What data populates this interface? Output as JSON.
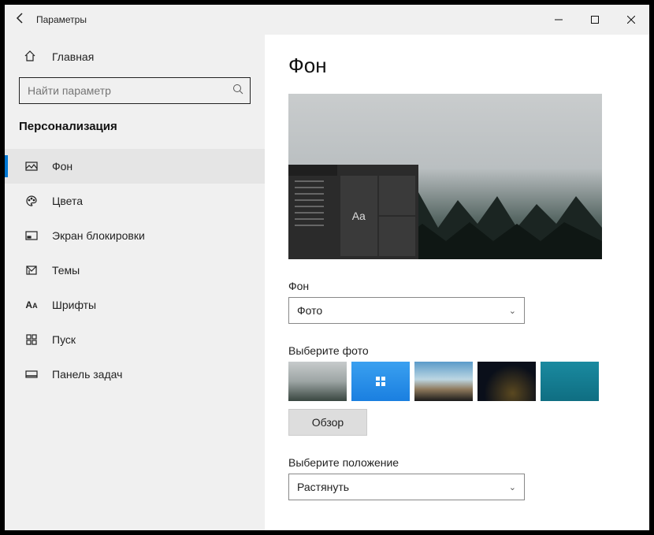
{
  "window": {
    "title": "Параметры"
  },
  "sidebar": {
    "home": "Главная",
    "search_placeholder": "Найти параметр",
    "category": "Персонализация",
    "items": [
      {
        "label": "Фон"
      },
      {
        "label": "Цвета"
      },
      {
        "label": "Экран блокировки"
      },
      {
        "label": "Темы"
      },
      {
        "label": "Шрифты"
      },
      {
        "label": "Пуск"
      },
      {
        "label": "Панель задач"
      }
    ]
  },
  "main": {
    "heading": "Фон",
    "preview_sample": "Aa",
    "bg_label": "Фон",
    "bg_value": "Фото",
    "choose_label": "Выберите фото",
    "browse": "Обзор",
    "fit_label": "Выберите положение",
    "fit_value": "Растянуть"
  }
}
